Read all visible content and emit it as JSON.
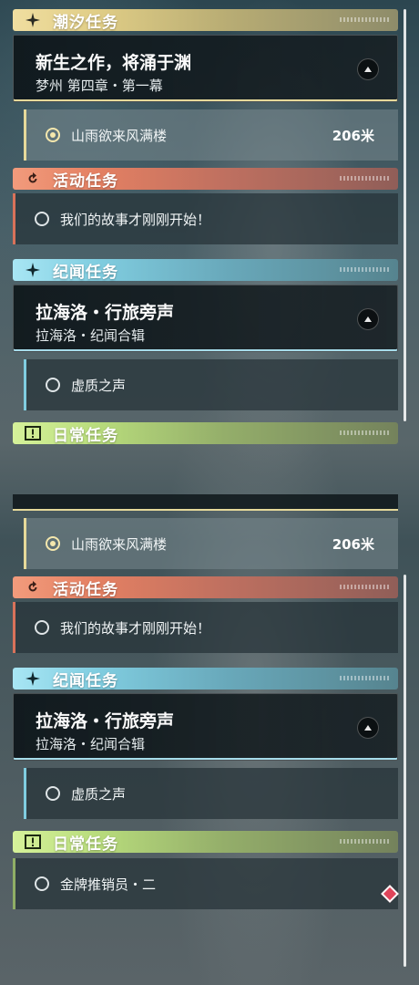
{
  "categories": {
    "tide": "潮汐任务",
    "event": "活动任务",
    "exploration": "纪闻任务",
    "daily": "日常任务"
  },
  "tide_quest": {
    "title": "新生之作，将涌于渊",
    "subtitle": "梦州 第四章・第一幕",
    "objective": "山雨欲来风满楼",
    "distance": "206米"
  },
  "event_quest": {
    "objective": "我们的故事才刚刚开始！"
  },
  "exploration_quest": {
    "title": "拉海洛・行旅旁声",
    "subtitle": "拉海洛・纪闻合辑",
    "objective": "虚质之声"
  },
  "daily_quest": {
    "objective": "金牌推销员・二"
  },
  "colors": {
    "tide": "#e6d99a",
    "event": "#e48062",
    "exploration": "#80cde0",
    "daily": "#b8dc7c",
    "tracker_marker": "#e0445a"
  },
  "icons": {
    "tide": "four-point-star-icon",
    "event": "refresh-icon",
    "exploration": "four-point-star-icon",
    "daily": "exclamation-icon",
    "collapse": "chevron-up-icon",
    "tracker": "diamond-marker-icon"
  }
}
